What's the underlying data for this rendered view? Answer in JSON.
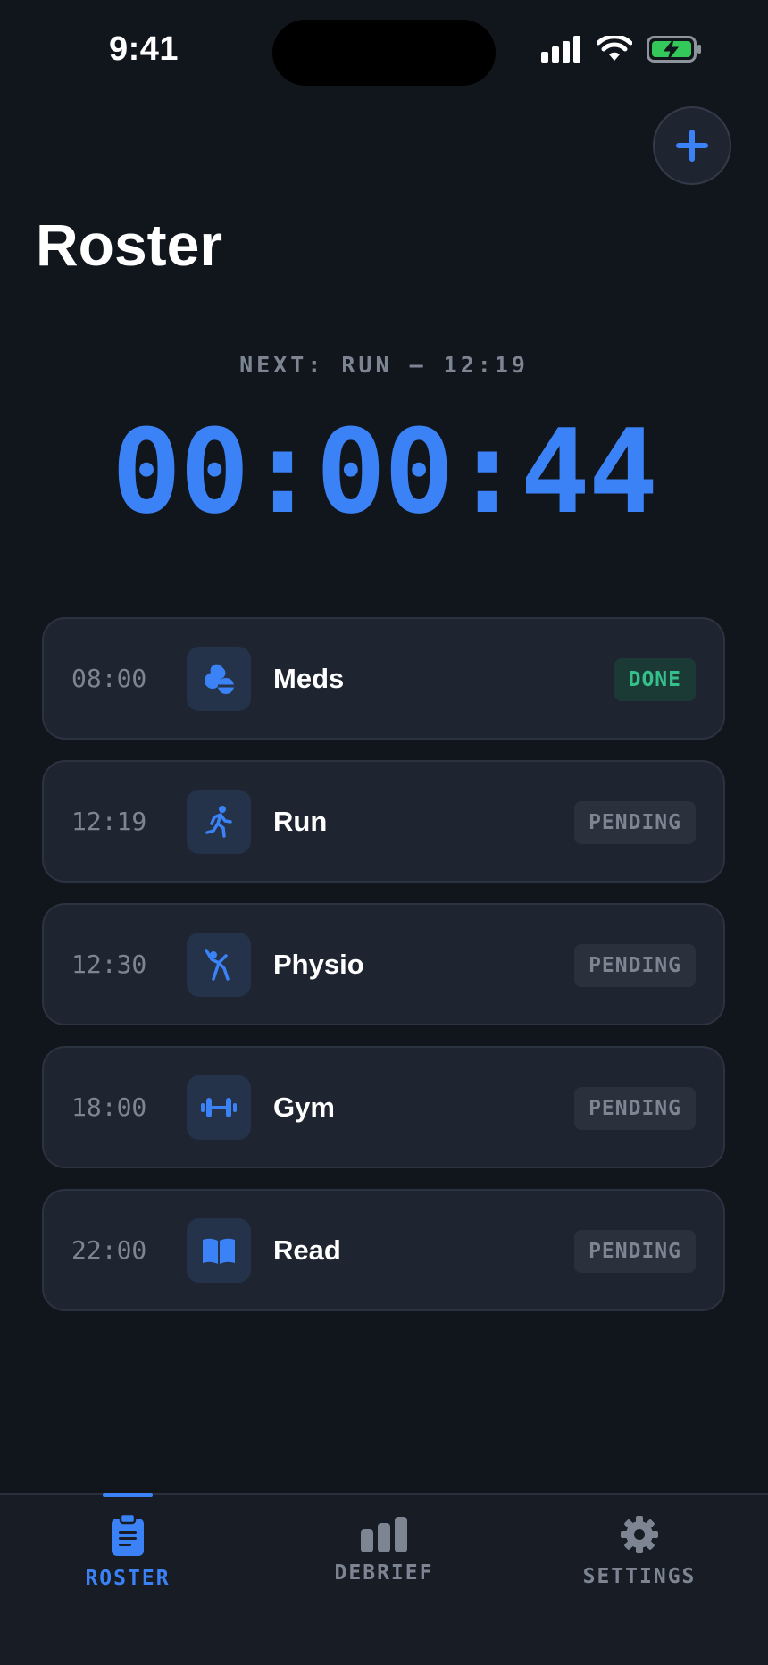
{
  "status_bar": {
    "time": "9:41"
  },
  "header": {
    "title": "Roster",
    "add_label": "+"
  },
  "timer": {
    "next_label": "NEXT: RUN — 12:19",
    "countdown": "00:00:44"
  },
  "tasks": [
    {
      "time": "08:00",
      "name": "Meds",
      "icon": "pill-icon",
      "status": "DONE"
    },
    {
      "time": "12:19",
      "name": "Run",
      "icon": "runner-icon",
      "status": "PENDING"
    },
    {
      "time": "12:30",
      "name": "Physio",
      "icon": "stretch-icon",
      "status": "PENDING"
    },
    {
      "time": "18:00",
      "name": "Gym",
      "icon": "dumbbell-icon",
      "status": "PENDING"
    },
    {
      "time": "22:00",
      "name": "Read",
      "icon": "book-icon",
      "status": "PENDING"
    }
  ],
  "tab_bar": {
    "tabs": [
      {
        "label": "ROSTER",
        "icon": "clipboard-icon",
        "active": true
      },
      {
        "label": "DEBRIEF",
        "icon": "bar-chart-icon",
        "active": false
      },
      {
        "label": "SETTINGS",
        "icon": "gear-icon",
        "active": false
      }
    ]
  },
  "colors": {
    "accent": "#3b82f6",
    "done": "#34c08a",
    "muted": "#7d8593",
    "background": "#11151c",
    "card": "#1f2530"
  }
}
